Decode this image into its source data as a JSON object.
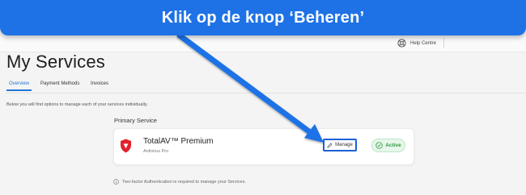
{
  "banner": {
    "text": "Klik op de knop ‘Beheren’"
  },
  "header": {
    "help_label": "Help Centre"
  },
  "page": {
    "title": "My Services",
    "tabs": [
      {
        "label": "Overview",
        "active": true
      },
      {
        "label": "Payment Methods",
        "active": false
      },
      {
        "label": "Invoices",
        "active": false
      }
    ],
    "intro": "Below you will find options to manage each of your services individually."
  },
  "service": {
    "section_title": "Primary Service",
    "name": "TotalAV™ Premium",
    "subtitle": "Antivirus Pro",
    "manage_label": "Manage",
    "status_label": "Active"
  },
  "notice": {
    "text": "Two-factor Authentication is required to manage your Services."
  },
  "colors": {
    "accent": "#1e72e6",
    "tab_active": "#2475d8",
    "brand_red": "#e2222b",
    "status_green": "#2e9a44",
    "highlight_border": "#1e5fd6"
  },
  "icons": {
    "help": "lifebuoy-icon",
    "brand": "shield-icon",
    "manage": "pencil-icon",
    "status": "check-circle-icon",
    "notice": "info-icon"
  }
}
